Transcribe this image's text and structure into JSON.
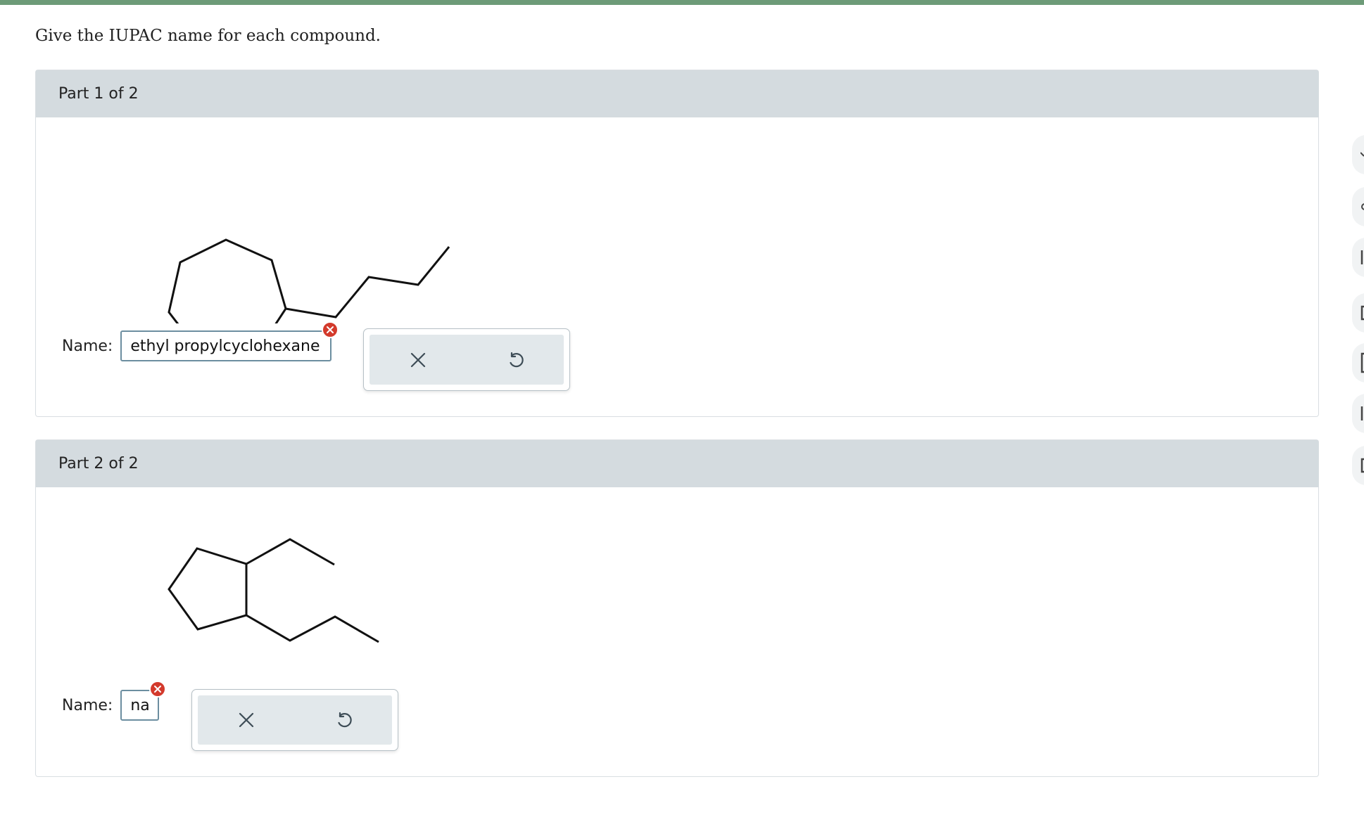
{
  "instruction": "Give the IUPAC name for each compound.",
  "parts": [
    {
      "title": "Part 1 of 2",
      "name_label": "Name:",
      "answer_value": "ethyl propylcyclohexane",
      "answer_status": "incorrect"
    },
    {
      "title": "Part 2 of 2",
      "name_label": "Name:",
      "answer_value": "na",
      "answer_status": "incorrect"
    }
  ],
  "tool_buttons": [
    "clear-x-icon",
    "undo-icon"
  ],
  "colors": {
    "top_bar": "#6d9b78",
    "part_header_bg": "#d4dbdf",
    "answer_border": "#6c8ea0",
    "error_badge": "#d33a2c",
    "tool_bg": "#e2e8eb"
  },
  "side_tab_icons": [
    "chevron-icon",
    "key-icon",
    "book-icon",
    "calculator-icon",
    "periodic-table-icon",
    "data-icon",
    "help-icon"
  ]
}
